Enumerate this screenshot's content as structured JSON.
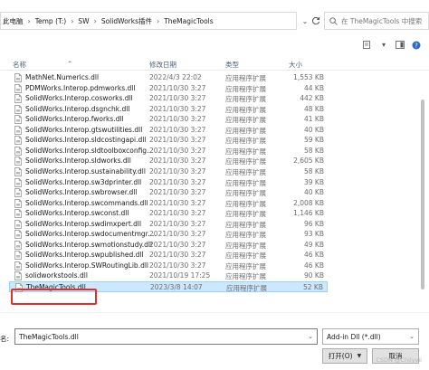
{
  "address": {
    "crumbs": [
      "此电脑",
      "Temp (T:)",
      "SW",
      "SolidWorks插件",
      "TheMagicTools"
    ],
    "separator": "›"
  },
  "search": {
    "placeholder": "在 TheMagicTools 中搜索"
  },
  "columns": {
    "name": "名称",
    "date": "修改日期",
    "type": "类型",
    "size": "大小"
  },
  "files": [
    {
      "name": "MathNet.Numerics.dll",
      "date": "2022/4/3 22:02",
      "type": "应用程序扩展",
      "size": "1,553 KB"
    },
    {
      "name": "PDMWorks.Interop.pdmworks.dll",
      "date": "2021/10/30 3:27",
      "type": "应用程序扩展",
      "size": "44 KB"
    },
    {
      "name": "SolidWorks.Interop.cosworks.dll",
      "date": "2021/10/30 3:27",
      "type": "应用程序扩展",
      "size": "442 KB"
    },
    {
      "name": "SolidWorks.Interop.dsgnchk.dll",
      "date": "2021/10/30 3:27",
      "type": "应用程序扩展",
      "size": "48 KB"
    },
    {
      "name": "SolidWorks.Interop.fworks.dll",
      "date": "2021/10/30 3:27",
      "type": "应用程序扩展",
      "size": "41 KB"
    },
    {
      "name": "SolidWorks.Interop.gtswutilities.dll",
      "date": "2021/10/30 3:27",
      "type": "应用程序扩展",
      "size": "40 KB"
    },
    {
      "name": "SolidWorks.Interop.sldcostingapi.dll",
      "date": "2021/10/30 3:27",
      "type": "应用程序扩展",
      "size": "59 KB"
    },
    {
      "name": "SolidWorks.Interop.sldtoolboxconfig...",
      "date": "2021/10/30 3:27",
      "type": "应用程序扩展",
      "size": "58 KB"
    },
    {
      "name": "SolidWorks.Interop.sldworks.dll",
      "date": "2021/10/30 3:27",
      "type": "应用程序扩展",
      "size": "2,605 KB"
    },
    {
      "name": "SolidWorks.Interop.sustainability.dll",
      "date": "2021/10/30 3:27",
      "type": "应用程序扩展",
      "size": "58 KB"
    },
    {
      "name": "SolidWorks.Interop.sw3dprinter.dll",
      "date": "2021/10/30 3:27",
      "type": "应用程序扩展",
      "size": "39 KB"
    },
    {
      "name": "SolidWorks.Interop.swbrowser.dll",
      "date": "2021/10/30 3:27",
      "type": "应用程序扩展",
      "size": "40 KB"
    },
    {
      "name": "SolidWorks.Interop.swcommands.dll",
      "date": "2021/10/30 3:27",
      "type": "应用程序扩展",
      "size": "2,008 KB"
    },
    {
      "name": "SolidWorks.Interop.swconst.dll",
      "date": "2021/10/30 3:27",
      "type": "应用程序扩展",
      "size": "1,146 KB"
    },
    {
      "name": "SolidWorks.Interop.swdimxpert.dll",
      "date": "2021/10/30 3:27",
      "type": "应用程序扩展",
      "size": "96 KB"
    },
    {
      "name": "SolidWorks.Interop.swdocumentmgr....",
      "date": "2021/10/30 3:27",
      "type": "应用程序扩展",
      "size": "93 KB"
    },
    {
      "name": "SolidWorks.Interop.swmotionstudy.dll",
      "date": "2021/10/30 3:27",
      "type": "应用程序扩展",
      "size": "49 KB"
    },
    {
      "name": "SolidWorks.Interop.swpublished.dll",
      "date": "2021/10/30 3:27",
      "type": "应用程序扩展",
      "size": "46 KB"
    },
    {
      "name": "SolidWorks.Interop.SWRoutingLib.dll",
      "date": "2021/10/30 3:27",
      "type": "应用程序扩展",
      "size": "46 KB"
    },
    {
      "name": "solidworkstools.dll",
      "date": "2021/10/19 17:25",
      "type": "应用程序扩展",
      "size": "90 KB"
    },
    {
      "name": "TheMagicTools.dll",
      "date": "2023/3/8 14:07",
      "type": "应用程序扩展",
      "size": "52 KB"
    }
  ],
  "selected_index": 20,
  "bottom": {
    "filename_label": "名:",
    "filename_value": "TheMagicTools.dll",
    "filter_value": "Add-in Dll (*.dll)",
    "open_label": "打开(O)",
    "cancel_label": "取消"
  },
  "watermark": "CSDN @Chilyvii",
  "colors": {
    "selection": "#cce8ff",
    "highlight_outline": "#e0302d",
    "header_text": "#4c607a"
  }
}
